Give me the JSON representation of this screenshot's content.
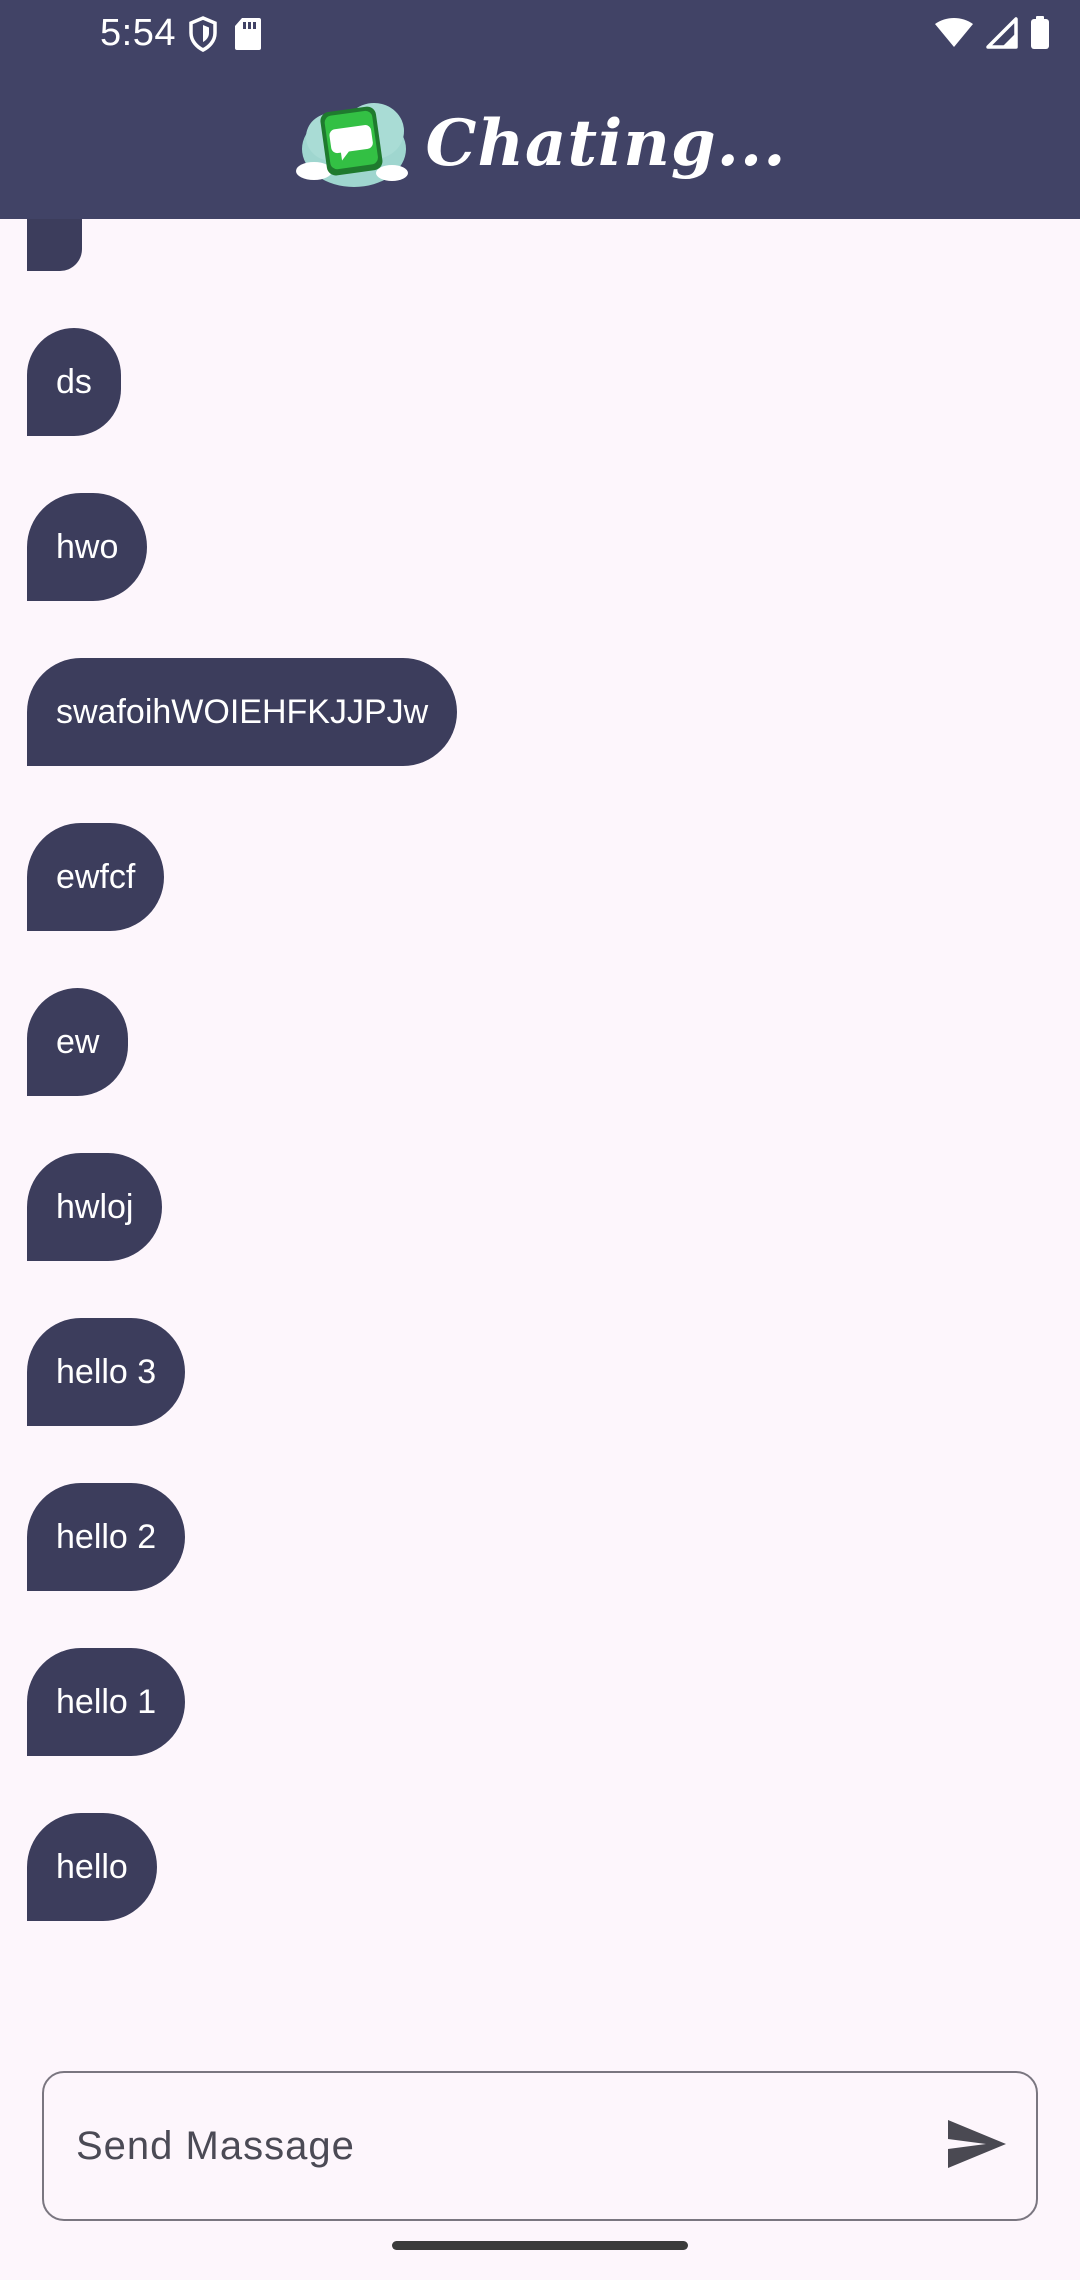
{
  "status_bar": {
    "time": "5:54"
  },
  "app_bar": {
    "title": "Chating..."
  },
  "messages": [
    {
      "text": "ds"
    },
    {
      "text": "hwo"
    },
    {
      "text": "swafoihWOIEHFKJJPJw"
    },
    {
      "text": "ewfcf"
    },
    {
      "text": "ew"
    },
    {
      "text": "hwloj"
    },
    {
      "text": "hello 3"
    },
    {
      "text": "hello 2"
    },
    {
      "text": "hello 1"
    },
    {
      "text": "hello"
    }
  ],
  "composer": {
    "placeholder": "Send Massage",
    "value": ""
  },
  "icons": {
    "send": "send-icon",
    "logo": "chat-cloud-logo"
  },
  "colors": {
    "app_bar": "#414366",
    "bubble": "#3c3d5c",
    "background": "#fdf6fc"
  }
}
